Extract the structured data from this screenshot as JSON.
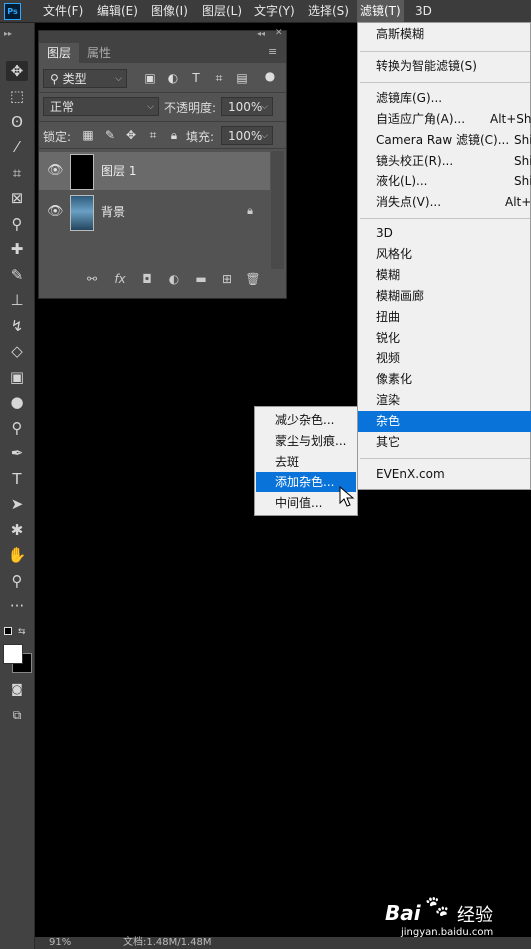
{
  "app": {
    "logo": "Ps"
  },
  "menubar": {
    "items": [
      {
        "label": "文件(F)"
      },
      {
        "label": "编辑(E)"
      },
      {
        "label": "图像(I)"
      },
      {
        "label": "图层(L)"
      },
      {
        "label": "文字(Y)"
      },
      {
        "label": "选择(S)"
      },
      {
        "label": "滤镜(T)",
        "active": true
      },
      {
        "label": "3D"
      }
    ]
  },
  "layers_panel": {
    "tabs": [
      "图层",
      "属性"
    ],
    "filter_label": "类型",
    "blend_mode": "正常",
    "opacity_label": "不透明度:",
    "opacity_value": "100%",
    "lock_label": "锁定:",
    "fill_label": "填充:",
    "fill_value": "100%",
    "layers": [
      {
        "name": "图层 1",
        "selected": true,
        "thumb_color": "#000000"
      },
      {
        "name": "背景",
        "selected": false,
        "locked": true,
        "thumb_color": "#3a6e96"
      }
    ],
    "footer_icons": [
      "link-icon",
      "fx-icon",
      "mask-icon",
      "adjustment-icon",
      "folder-icon",
      "new-layer-icon",
      "trash-icon"
    ],
    "fx_label": "fx"
  },
  "filter_menu": {
    "items": [
      {
        "label": "高斯模糊",
        "shortcut": ""
      },
      {
        "label": "转换为智能滤镜(S)",
        "shortcut": ""
      },
      {
        "label": "滤镜库(G)...",
        "shortcut": ""
      },
      {
        "label": "自适应广角(A)...",
        "shortcut": "Alt+Shi"
      },
      {
        "label": "Camera Raw 滤镜(C)...",
        "shortcut": "Shi"
      },
      {
        "label": "镜头校正(R)...",
        "shortcut": "Shi"
      },
      {
        "label": "液化(L)...",
        "shortcut": "Shi"
      },
      {
        "label": "消失点(V)...",
        "shortcut": "Alt+"
      },
      {
        "label": "3D",
        "shortcut": ""
      },
      {
        "label": "风格化",
        "shortcut": ""
      },
      {
        "label": "模糊",
        "shortcut": ""
      },
      {
        "label": "模糊画廊",
        "shortcut": ""
      },
      {
        "label": "扭曲",
        "shortcut": ""
      },
      {
        "label": "锐化",
        "shortcut": ""
      },
      {
        "label": "视频",
        "shortcut": ""
      },
      {
        "label": "像素化",
        "shortcut": ""
      },
      {
        "label": "渲染",
        "shortcut": ""
      },
      {
        "label": "杂色",
        "shortcut": "",
        "highlighted": true
      },
      {
        "label": "其它",
        "shortcut": ""
      },
      {
        "label": "EVEnX.com",
        "shortcut": ""
      }
    ]
  },
  "noise_submenu": {
    "items": [
      {
        "label": "减少杂色..."
      },
      {
        "label": "蒙尘与划痕..."
      },
      {
        "label": "去斑"
      },
      {
        "label": "添加杂色...",
        "highlighted": true
      },
      {
        "label": "中间值..."
      }
    ]
  },
  "status_bar": {
    "zoom": "91%",
    "doc_info": "文档:1.48M/1.48M"
  },
  "watermark": {
    "brand": "Bai",
    "brand2": "经验",
    "url": "jingyan.baidu.com"
  },
  "colors": {
    "menu_highlight": "#0a73d9",
    "panel_bg": "#535353",
    "toolbar_bg": "#424242"
  }
}
